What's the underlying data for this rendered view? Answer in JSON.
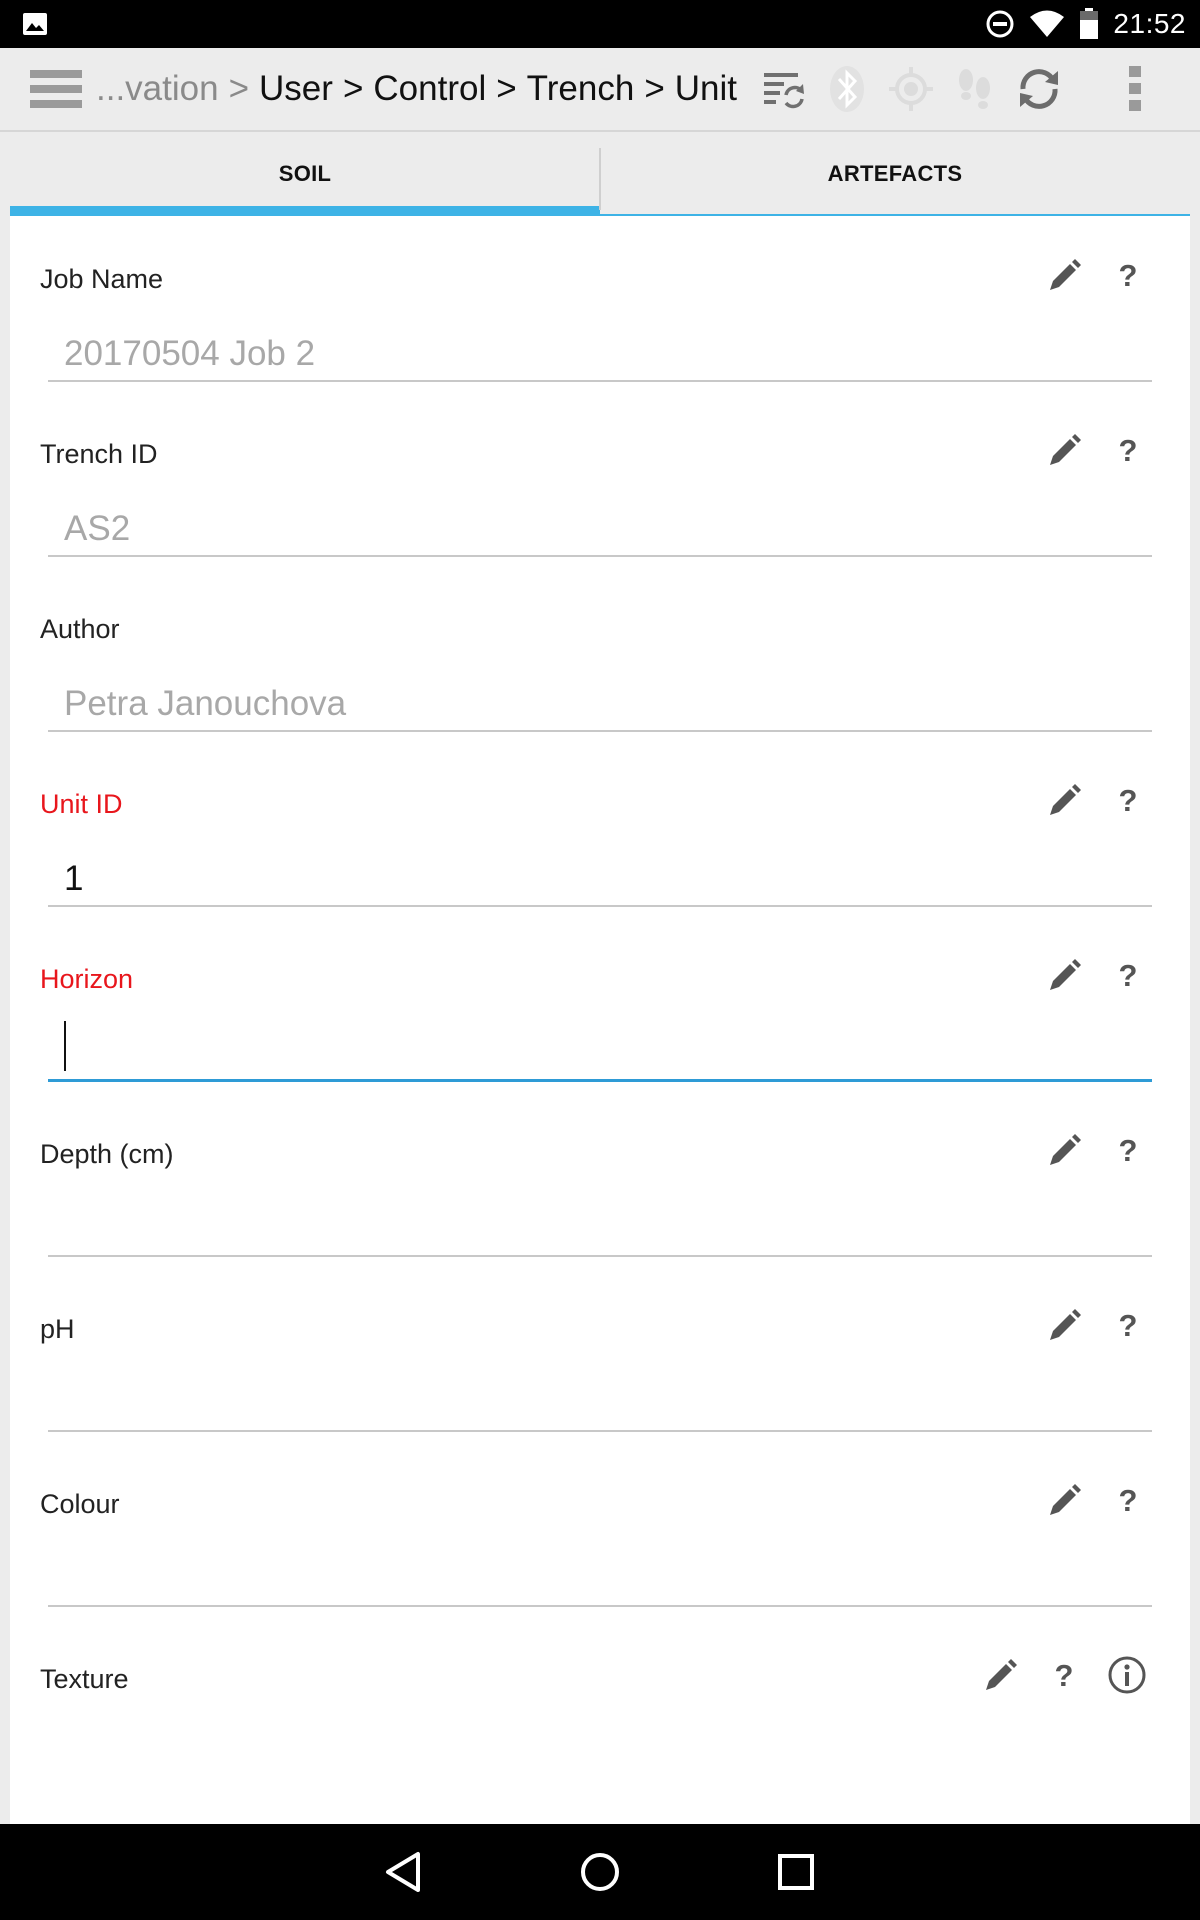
{
  "status_bar": {
    "time": "21:52",
    "icons": [
      "image-icon",
      "do-not-disturb-icon",
      "wifi-icon",
      "battery-icon"
    ]
  },
  "action_bar": {
    "breadcrumb": {
      "truncated": "...vation",
      "items": [
        "User",
        "Control",
        "Trench",
        "Unit"
      ],
      "separator": ">"
    },
    "icons": [
      "menu-icon",
      "sync-settings-icon",
      "bluetooth-icon",
      "gps-icon",
      "tracker-icon",
      "sync-icon",
      "overflow-menu-icon"
    ]
  },
  "tabs": [
    {
      "label": "SOIL",
      "active": true
    },
    {
      "label": "ARTEFACTS",
      "active": false
    }
  ],
  "form": {
    "fields": [
      {
        "label": "Job Name",
        "required": false,
        "value": "20170504 Job 2",
        "state": "placeholder",
        "icons": [
          "pencil-icon",
          "help-icon"
        ]
      },
      {
        "label": "Trench ID",
        "required": false,
        "value": "AS2",
        "state": "placeholder",
        "icons": [
          "pencil-icon",
          "help-icon"
        ]
      },
      {
        "label": "Author",
        "required": false,
        "value": "Petra Janouchova",
        "state": "placeholder",
        "icons": []
      },
      {
        "label": "Unit ID",
        "required": true,
        "value": "1",
        "state": "value",
        "icons": [
          "pencil-icon",
          "help-icon"
        ]
      },
      {
        "label": "Horizon",
        "required": true,
        "value": "",
        "state": "focused",
        "icons": [
          "pencil-icon",
          "help-icon"
        ]
      },
      {
        "label": "Depth (cm)",
        "required": false,
        "value": "",
        "state": "empty",
        "icons": [
          "pencil-icon",
          "help-icon"
        ]
      },
      {
        "label": "pH",
        "required": false,
        "value": "",
        "state": "empty",
        "icons": [
          "pencil-icon",
          "help-icon"
        ]
      },
      {
        "label": "Colour",
        "required": false,
        "value": "",
        "state": "empty",
        "icons": [
          "pencil-icon",
          "help-icon"
        ]
      },
      {
        "label": "Texture",
        "required": false,
        "value": "",
        "state": "empty",
        "icons": [
          "pencil-icon",
          "help-icon",
          "info-icon"
        ]
      }
    ],
    "help_symbol": "?"
  },
  "colors": {
    "accent": "#3db3e6",
    "focus_underline": "#2e9bd6",
    "required_label": "#e8161c",
    "placeholder_text": "#a8a8a8"
  },
  "nav_bar": {
    "icons": [
      "back-icon",
      "home-icon",
      "recents-icon"
    ]
  }
}
